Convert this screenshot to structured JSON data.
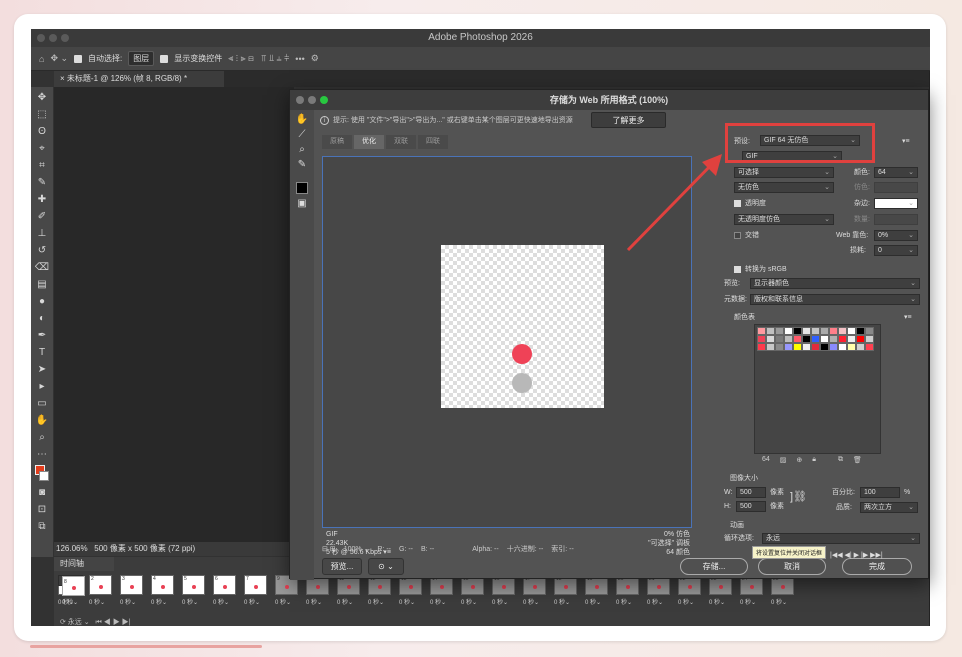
{
  "app": {
    "title": "Adobe Photoshop 2026"
  },
  "options_bar": {
    "auto_select_label": "自动选择:",
    "auto_select_value": "图层",
    "show_transform_label": "显示变换控件",
    "more": "•••"
  },
  "document_tab": {
    "label": "未标题-1 @ 126% (帧 8, RGB/8) *"
  },
  "status_bar": {
    "zoom": "126.06%",
    "info": "500 像素 x 500 像素 (72 ppi)"
  },
  "timeline": {
    "title": "时间轴",
    "frame_delay": "0 秒",
    "frames": [
      "1",
      "2",
      "3",
      "4",
      "5",
      "6",
      "7",
      "8",
      "9",
      "10",
      "11",
      "12",
      "13",
      "14",
      "15",
      "16",
      "17",
      "18",
      "19",
      "20",
      "21",
      "22",
      "23",
      "24",
      "25"
    ],
    "selected_frame": "8",
    "loop_value": "永远"
  },
  "dialog": {
    "title": "存储为 Web 所用格式 (100%)",
    "hint": "提示: 使用 \"文件\">\"导出\">\"导出为...\" 或右键单击某个图层可更快速地导出资源",
    "learn_more": "了解更多",
    "tabs": [
      "原稿",
      "优化",
      "双联",
      "四联"
    ],
    "active_tab": "优化",
    "preview_info_left": [
      "GIF",
      "22.43K",
      "5 秒 @ 56.6 Kbps"
    ],
    "preview_info_right": [
      "0% 仿色",
      "\"可选择\" 调板",
      "64 颜色"
    ],
    "zoom": "100%",
    "readouts": [
      "R: --",
      "G: --",
      "B: --",
      "Alpha: --",
      "十六进制: --",
      "索引: --"
    ],
    "buttons": {
      "preview": "预览...",
      "save": "存储...",
      "cancel": "取消",
      "done": "完成"
    },
    "tooltip": "将设置复位并关闭对话框"
  },
  "settings": {
    "preset_label": "预设:",
    "preset_value": "GIF 64 无仿色",
    "format": "GIF",
    "reduction": "可选择",
    "colors_label": "颜色:",
    "colors_value": "64",
    "dither": "无仿色",
    "dither_amount_label": "仿色:",
    "transparency_label": "透明度",
    "matte_label": "杂边:",
    "trans_dither": "无透明度仿色",
    "amount_label": "数量:",
    "interlace_label": "交错",
    "web_snap_label": "Web 靠色:",
    "web_snap_value": "0%",
    "lossy_label": "损耗:",
    "lossy_value": "0",
    "convert_srgb_label": "转换为 sRGB",
    "preview_label": "预览:",
    "preview_value": "显示器颜色",
    "metadata_label": "元数据:",
    "metadata_value": "版权和联系信息",
    "color_table_label": "颜色表",
    "color_count": "64",
    "image_size_label": "图像大小",
    "width_label": "W:",
    "width_value": "500",
    "height_label": "H:",
    "height_value": "500",
    "pixels_unit": "像素",
    "percent_label": "百分比:",
    "percent_value": "100",
    "percent_unit": "%",
    "quality_label": "品质:",
    "quality_value": "两次立方",
    "animation_label": "动画",
    "loop_label": "循环选项:",
    "loop_value": "永远"
  },
  "colors": {
    "highlight": "#e0413e",
    "preview_red": "#ef4257",
    "preview_grey": "#b8b8b8",
    "color_table": [
      "#ff9aa0",
      "#c0c0c0",
      "#9a9a9a",
      "#ffffff",
      "#000000",
      "#e6e6e6",
      "#c4c4c4",
      "#aaaaaa",
      "#ff7f8a",
      "#f3c0c4",
      "#ffffff",
      "#000000",
      "#888888",
      "#ef4257",
      "#d9d9d9",
      "#7a7a7a",
      "#bdbdbd",
      "#ff5a6a",
      "#000000",
      "#3060ff",
      "#ffffff",
      "#b0b0b0",
      "#ff2030",
      "#efefef",
      "#ff0000",
      "#cfcfcf",
      "#ff3a4c",
      "#c8c8c8",
      "#8a8a8a",
      "#9898ff",
      "#ffff00",
      "#f0f0f0",
      "#e22b3c",
      "#000000",
      "#8a8aff",
      "#ffffff",
      "#ffffaa",
      "#d0d0d0",
      "#ff4050"
    ]
  },
  "icons": [
    "home-icon",
    "move-icon",
    "hand-icon",
    "zoom-icon",
    "eyedropper-icon",
    "slice-icon",
    "gear-icon"
  ]
}
